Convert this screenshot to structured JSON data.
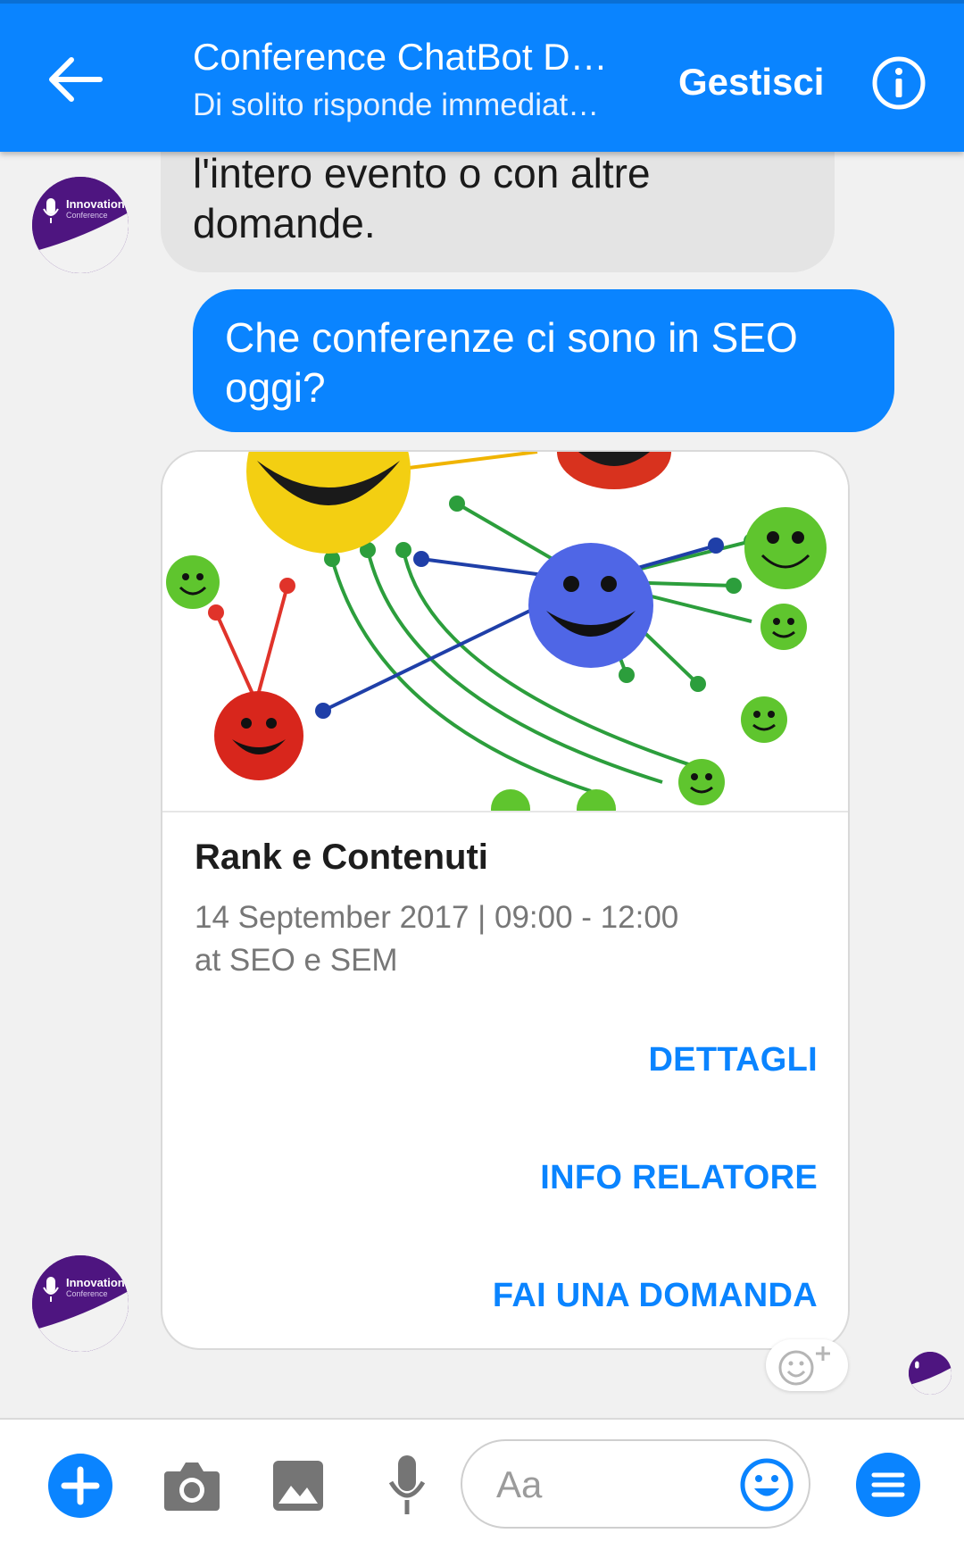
{
  "header": {
    "title": "Conference ChatBot De…",
    "subtitle": "Di solito risponde immediat…",
    "manage_label": "Gestisci",
    "accent_color": "#0a84ff"
  },
  "messages": {
    "incoming_text_line1": "l'intero evento o con altre",
    "incoming_text_line2": "domande.",
    "outgoing_text_line1": "Che conferenze ci sono in SEO",
    "outgoing_text_line2": "oggi?"
  },
  "avatar": {
    "brand_line1": "Innovation",
    "brand_line2": "Conference"
  },
  "card": {
    "image_icon": "smiley-network-image",
    "title": "Rank e Contenuti",
    "date_line": "14 September 2017 | 09:00 - 12:00",
    "location_line": "at SEO e SEM",
    "buttons": [
      "DETTAGLI",
      "INFO RELATORE",
      "FAI UNA DOMANDA"
    ]
  },
  "composer": {
    "placeholder": "Aa",
    "icons": [
      "plus-icon",
      "camera-icon",
      "image-icon",
      "microphone-icon",
      "emoji-icon",
      "menu-icon"
    ]
  }
}
